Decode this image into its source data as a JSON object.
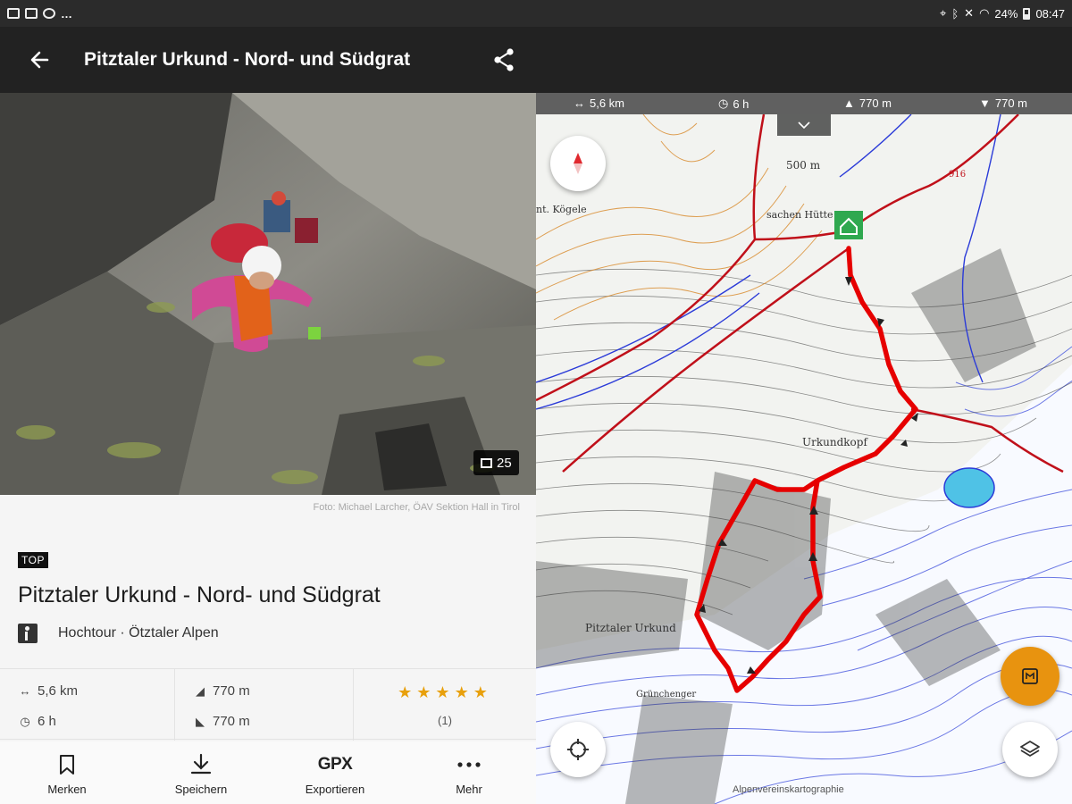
{
  "status_bar": {
    "battery": "24%",
    "time": "08:47"
  },
  "header": {
    "title": "Pitztaler Urkund - Nord- und Südgrat"
  },
  "photo": {
    "count": "25",
    "credit": "Foto: Michael Larcher, ÖAV Sektion Hall in Tirol"
  },
  "tour": {
    "badge": "TOP",
    "title": "Pitztaler Urkund - Nord- und Südgrat",
    "category": "Hochtour · Ötztaler Alpen"
  },
  "stats": {
    "distance": "5,6 km",
    "duration": "6 h",
    "ascent": "770 m",
    "descent": "770 m",
    "rating_stars": 5,
    "rating_count": "(1)"
  },
  "actions": [
    {
      "label": "Merken",
      "icon": "bookmark-icon"
    },
    {
      "label": "Speichern",
      "icon": "download-icon"
    },
    {
      "label": "Exportieren",
      "icon_text": "GPX"
    },
    {
      "label": "Mehr",
      "icon": "more-icon"
    }
  ],
  "map": {
    "stats": {
      "distance": "5,6 km",
      "duration": "6 h",
      "ascent": "770 m",
      "descent": "770 m"
    },
    "labels": {
      "urkundkopf": "Urkundkopf",
      "pitztaler_urkund": "Pitztaler Urkund",
      "grubach": "Grünchenger",
      "alpenverein": "Alpenvereinskartographie",
      "contour_500": "500 m",
      "route_label": "916",
      "koglkopf": "nt. Kögele",
      "huette": "sachen Hütte"
    },
    "colors": {
      "route": "#e60000",
      "accent": "#e8930f",
      "hut": "#2fa84f"
    }
  }
}
